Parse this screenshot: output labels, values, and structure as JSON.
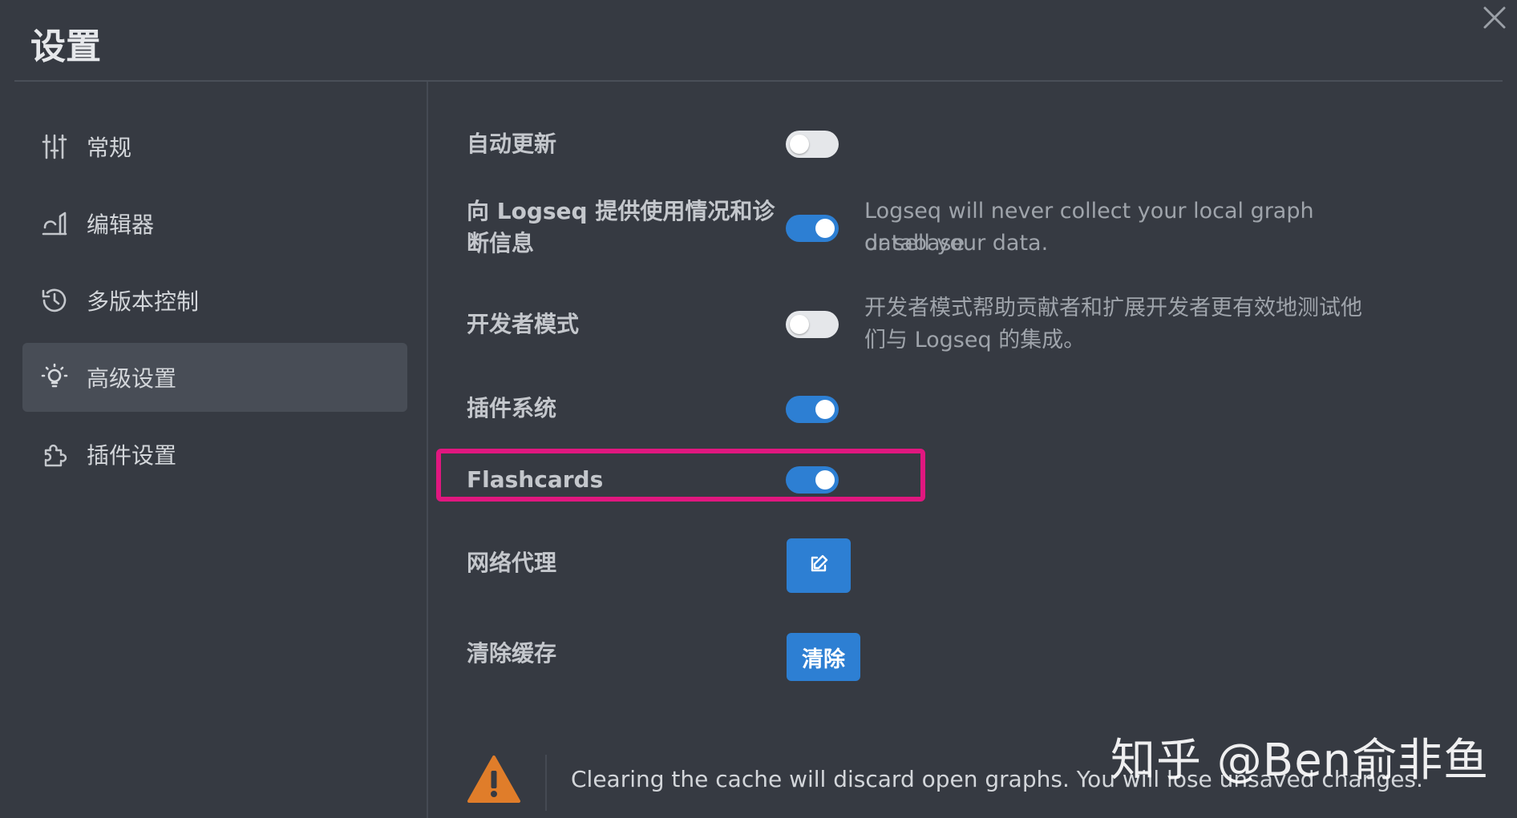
{
  "window": {
    "title": "设置"
  },
  "sidebar": {
    "items": [
      {
        "label": "常规",
        "icon": "sliders-icon",
        "active": false
      },
      {
        "label": "编辑器",
        "icon": "editor-icon",
        "active": false
      },
      {
        "label": "多版本控制",
        "icon": "history-icon",
        "active": false
      },
      {
        "label": "高级设置",
        "icon": "lightbulb-icon",
        "active": true
      },
      {
        "label": "插件设置",
        "icon": "puzzle-icon",
        "active": false
      }
    ]
  },
  "settings": {
    "auto_update": {
      "label": "自动更新",
      "enabled": false
    },
    "telemetry": {
      "label_line1": "向 Logseq 提供使用情况和诊",
      "label_line2": "断信息",
      "enabled": true,
      "desc_line1": "Logseq will never collect your local graph database",
      "desc_line2": "or sell your data."
    },
    "developer_mode": {
      "label": "开发者模式",
      "enabled": false,
      "desc_line1": "开发者模式帮助贡献者和扩展开发者更有效地测试他",
      "desc_line2": "们与 Logseq 的集成。"
    },
    "plugin_system": {
      "label": "插件系统",
      "enabled": true
    },
    "flashcards": {
      "label": "Flashcards",
      "enabled": true
    },
    "network_proxy": {
      "label": "网络代理",
      "button_icon": "edit-icon"
    },
    "clear_cache": {
      "label": "清除缓存",
      "button_label": "清除"
    }
  },
  "warning": {
    "icon": "warning-icon",
    "text": "Clearing the cache will discard open graphs. You will lose unsaved changes."
  },
  "watermark": {
    "text": "知乎 @Ben俞非鱼"
  },
  "colors": {
    "background": "#363a42",
    "accent": "#2d7fd3",
    "highlight": "#e0177f",
    "warning": "#e07d2a"
  }
}
